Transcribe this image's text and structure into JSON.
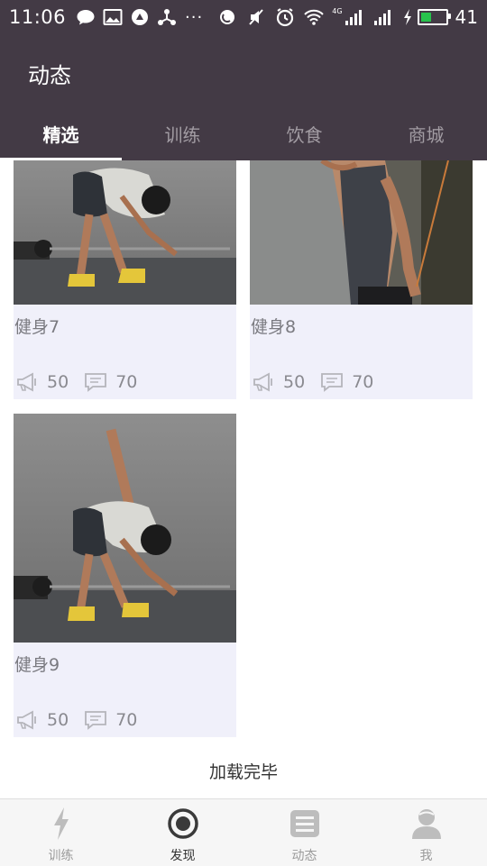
{
  "status_bar": {
    "time": "11:06",
    "left_icons": [
      "chat-bubble-icon",
      "image-icon",
      "circle-arrow-icon",
      "share-nodes-icon"
    ],
    "more": "···",
    "right_icons": [
      "no-disturb-icon",
      "silent-icon",
      "alarm-icon",
      "wifi-icon"
    ],
    "network_label": "4G",
    "battery_percent": "41",
    "battery_level": 0.41,
    "battery_color": "#27c24c"
  },
  "header": {
    "title": "动态",
    "tabs": [
      {
        "label": "精选",
        "active": true
      },
      {
        "label": "训练",
        "active": false
      },
      {
        "label": "饮食",
        "active": false
      },
      {
        "label": "商城",
        "active": false
      }
    ],
    "background": "#433a45"
  },
  "feed": {
    "items": [
      {
        "title": "健身7",
        "likes": "50",
        "comments": "70"
      },
      {
        "title": "健身8",
        "likes": "50",
        "comments": "70"
      },
      {
        "title": "健身9",
        "likes": "50",
        "comments": "70"
      }
    ],
    "footer_text": "加载完毕"
  },
  "bottom_nav": {
    "items": [
      {
        "label": "训练",
        "icon": "lightning-icon",
        "active": false
      },
      {
        "label": "发现",
        "icon": "target-circle-icon",
        "active": true
      },
      {
        "label": "动态",
        "icon": "news-list-icon",
        "active": false
      },
      {
        "label": "我",
        "icon": "user-icon",
        "active": false
      }
    ]
  }
}
